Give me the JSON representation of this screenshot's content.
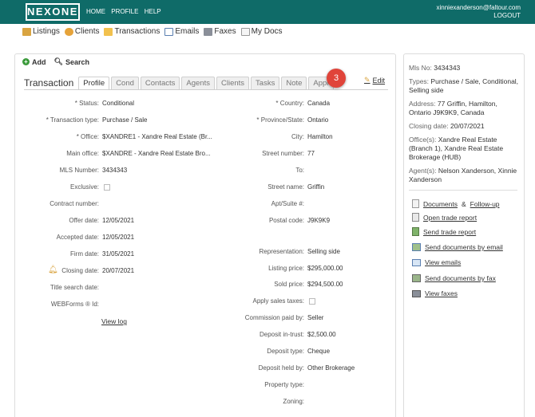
{
  "app": {
    "logo": "NEXONE",
    "topnav": [
      "HOME",
      "PROFILE",
      "HELP"
    ],
    "user_email": "xinniexanderson@faltour.com",
    "logout": "LOGOUT"
  },
  "modules": [
    "Listings",
    "Clients",
    "Transactions",
    "Emails",
    "Faxes",
    "My Docs"
  ],
  "actions": {
    "add": "Add",
    "search": "Search"
  },
  "tabs": {
    "title": "Transaction",
    "items": [
      "Profile",
      "Cond",
      "Contacts",
      "Agents",
      "Clients",
      "Tasks",
      "Note",
      "Appr"
    ],
    "active": "Profile"
  },
  "badge": "3",
  "edit_label": "Edit",
  "left_fields": [
    {
      "label": "* Status:",
      "value": "Conditional"
    },
    {
      "label": "* Transaction type:",
      "value": "Purchase / Sale"
    },
    {
      "label": "* Office:",
      "value": "$XANDRE1 - Xandre Real Estate (Br..."
    },
    {
      "label": "Main office:",
      "value": "$XANDRE - Xandre Real Estate Bro..."
    },
    {
      "label": "MLS Number:",
      "value": "3434343"
    },
    {
      "label": "Exclusive:",
      "value": ""
    },
    {
      "label": "Contract number:",
      "value": ""
    },
    {
      "label": "Offer date:",
      "value": "12/05/2021"
    },
    {
      "label": "Accepted date:",
      "value": "12/05/2021"
    },
    {
      "label": "Firm date:",
      "value": "31/05/2021"
    },
    {
      "label": "Closing date:",
      "value": "20/07/2021"
    },
    {
      "label": "Title search date:",
      "value": ""
    },
    {
      "label": "WEBForms ® Id:",
      "value": ""
    }
  ],
  "view_log": "View log",
  "right_fields": [
    {
      "label": "* Country:",
      "value": "Canada"
    },
    {
      "label": "* Province/State:",
      "value": "Ontario"
    },
    {
      "label": "City:",
      "value": "Hamilton"
    },
    {
      "label": "Street number:",
      "value": "77"
    },
    {
      "label": "To:",
      "value": ""
    },
    {
      "label": "Street name:",
      "value": "Griffin"
    },
    {
      "label": "Apt/Suite #:",
      "value": ""
    },
    {
      "label": "Postal code:",
      "value": "J9K9K9"
    },
    {
      "label": "Representation:",
      "value": "Selling side"
    },
    {
      "label": "Listing price:",
      "value": "$295,000.00"
    },
    {
      "label": "Sold price:",
      "value": "$294,500.00"
    },
    {
      "label": "Apply sales taxes:",
      "value": ""
    },
    {
      "label": "Commission paid by:",
      "value": "Seller"
    },
    {
      "label": "Deposit in-trust:",
      "value": "$2,500.00"
    },
    {
      "label": "Deposit type:",
      "value": "Cheque"
    },
    {
      "label": "Deposit held by:",
      "value": "Other Brokerage"
    },
    {
      "label": "Property type:",
      "value": ""
    },
    {
      "label": "Zoning:",
      "value": ""
    }
  ],
  "summary": {
    "mls_label": "Mls No:",
    "mls": "3434343",
    "types_label": "Types:",
    "types": "Purchase / Sale, Conditional, Selling side",
    "address_label": "Address:",
    "address": "77 Griffin, Hamilton, Ontario J9K9K9, Canada",
    "closing_label": "Closing date:",
    "closing": "20/07/2021",
    "offices_label": "Office(s):",
    "offices": "Xandre Real Estate (Branch 1), Xandre Real Estate Brokerage (HUB)",
    "agents_label": "Agent(s):",
    "agents": "Nelson Xanderson, Xinnie Xanderson"
  },
  "side_links": {
    "documents": "Documents",
    "amp": "&",
    "followup": "Follow-up",
    "open_trade": "Open trade report",
    "send_trade": "Send trade report",
    "send_docs_email": "Send documents by email",
    "view_emails": "View emails",
    "send_docs_fax": "Send documents by fax",
    "view_faxes": "View faxes"
  },
  "colors": {
    "topbar": "#0f6b68",
    "badge": "#e0443a"
  }
}
